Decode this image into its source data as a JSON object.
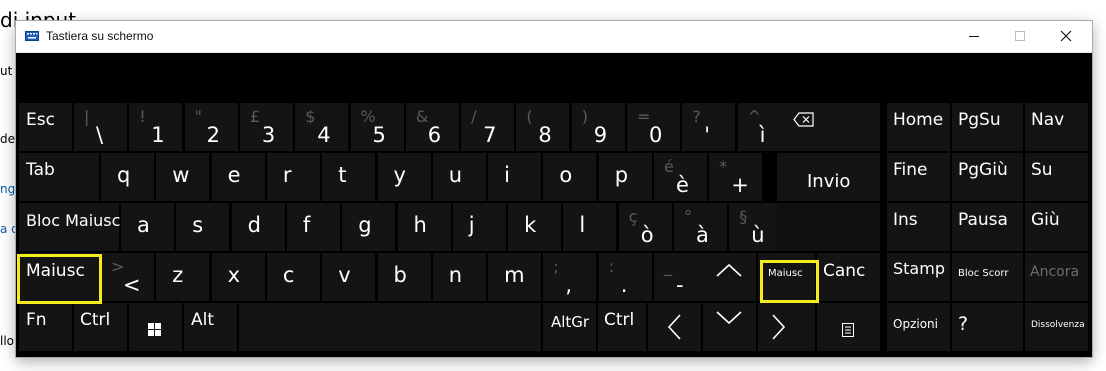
{
  "background": {
    "title_fragment": "di input",
    "fragments": [
      "ut c",
      "de",
      "ng",
      "a d",
      "llo"
    ]
  },
  "window": {
    "title": "Tastiera su schermo",
    "icon": "keyboard-icon",
    "controls": [
      "minimize-icon",
      "maximize-icon",
      "close-icon"
    ]
  },
  "keyboard": {
    "row1": {
      "esc": "Esc",
      "keys": [
        {
          "main": "\\",
          "sub": "|"
        },
        {
          "main": "1",
          "sub": "!"
        },
        {
          "main": "2",
          "sub": "\""
        },
        {
          "main": "3",
          "sub": "£"
        },
        {
          "main": "4",
          "sub": "$"
        },
        {
          "main": "5",
          "sub": "%"
        },
        {
          "main": "6",
          "sub": "&"
        },
        {
          "main": "7",
          "sub": "/"
        },
        {
          "main": "8",
          "sub": "("
        },
        {
          "main": "9",
          "sub": ")"
        },
        {
          "main": "0",
          "sub": "="
        },
        {
          "main": "'",
          "sub": "?"
        },
        {
          "main": "ì",
          "sub": "^"
        }
      ],
      "backspace": "backspace-icon"
    },
    "row2": {
      "tab": "Tab",
      "keys": [
        {
          "main": "q"
        },
        {
          "main": "w"
        },
        {
          "main": "e"
        },
        {
          "main": "r"
        },
        {
          "main": "t"
        },
        {
          "main": "y"
        },
        {
          "main": "u"
        },
        {
          "main": "i"
        },
        {
          "main": "o"
        },
        {
          "main": "p"
        },
        {
          "main": "è",
          "sub": "é"
        },
        {
          "main": "+",
          "sub": "*"
        }
      ],
      "enter": "Invio"
    },
    "row3": {
      "caps": "Bloc Maiusc",
      "keys": [
        {
          "main": "a"
        },
        {
          "main": "s"
        },
        {
          "main": "d"
        },
        {
          "main": "f"
        },
        {
          "main": "g"
        },
        {
          "main": "h"
        },
        {
          "main": "j"
        },
        {
          "main": "k"
        },
        {
          "main": "l"
        },
        {
          "main": "ò",
          "sub": "ç"
        },
        {
          "main": "à",
          "sub": "°"
        },
        {
          "main": "ù",
          "sub": "§"
        }
      ]
    },
    "row4": {
      "shift_left": "Maiusc",
      "keys": [
        {
          "main": "<",
          "sub": ">"
        },
        {
          "main": "z"
        },
        {
          "main": "x"
        },
        {
          "main": "c"
        },
        {
          "main": "v"
        },
        {
          "main": "b"
        },
        {
          "main": "n"
        },
        {
          "main": "m"
        },
        {
          "main": ",",
          "sub": ";"
        },
        {
          "main": ".",
          "sub": ":"
        },
        {
          "main": "-",
          "sub": "_"
        }
      ],
      "up": "arrow-up-icon",
      "shift_right": "Maiusc",
      "delete": "Canc"
    },
    "row5": {
      "fn": "Fn",
      "ctrl_left": "Ctrl",
      "win": "windows-icon",
      "alt": "Alt",
      "altgr": "AltGr",
      "ctrl_right": "Ctrl",
      "left": "arrow-left-icon",
      "down": "arrow-down-icon",
      "right": "arrow-right-icon",
      "menu": "context-menu-icon"
    },
    "nav": {
      "home": "Home",
      "pgup": "PgSu",
      "nav": "Nav",
      "end": "Fine",
      "pgdn": "PgGiù",
      "up": "Su",
      "ins": "Ins",
      "pause": "Pausa",
      "down": "Giù",
      "prtscn": "Stamp",
      "scrlk": "Bloc Scorr",
      "dock": "Ancora",
      "options": "Opzioni",
      "help": "?",
      "fade": "Dissolvenza"
    }
  },
  "colors": {
    "highlight": "#f4ec1e",
    "key_bg": "#141414",
    "window_bg": "#000000"
  }
}
